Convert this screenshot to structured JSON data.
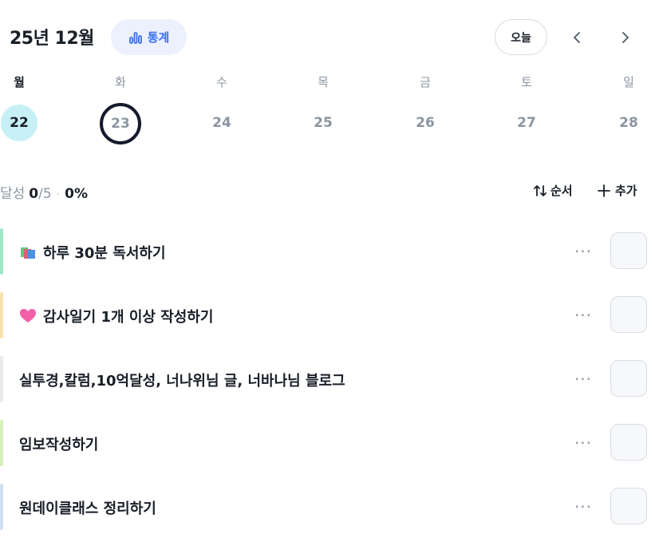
{
  "header": {
    "month_title": "25년 12월",
    "stats_label": "통계",
    "today_label": "오늘"
  },
  "week": {
    "days": [
      "월",
      "화",
      "수",
      "목",
      "금",
      "토",
      "일"
    ],
    "dates": [
      "22",
      "23",
      "24",
      "25",
      "26",
      "27",
      "28"
    ],
    "selected_index": 0,
    "today_index": 1
  },
  "summary": {
    "label": "달성",
    "done": "0",
    "total": "/5",
    "separator": "·",
    "percent": "0%"
  },
  "actions": {
    "order_label": "순서",
    "add_label": "추가"
  },
  "tasks": [
    {
      "title": "하루 30분 독서하기",
      "icon": "books-icon",
      "color": "#9ee6c9"
    },
    {
      "title": "감사일기 1개 이상 작성하기",
      "icon": "pink-heart-icon",
      "color": "#f8e2b0"
    },
    {
      "title": "실투경,칼럼,10억달성, 너나위님 글, 너바나님 블로그",
      "icon": "",
      "color": "#e9ebee"
    },
    {
      "title": "임보작성하기",
      "icon": "",
      "color": "#d6f0b8"
    },
    {
      "title": "원데이클래스 정리하기",
      "icon": "",
      "color": "#d0def2"
    }
  ],
  "colors": {
    "accent": "#3b6ff5",
    "selected_bg": "#c6f0f5",
    "today_ring": "#131a2b",
    "muted": "#8b95a1"
  }
}
